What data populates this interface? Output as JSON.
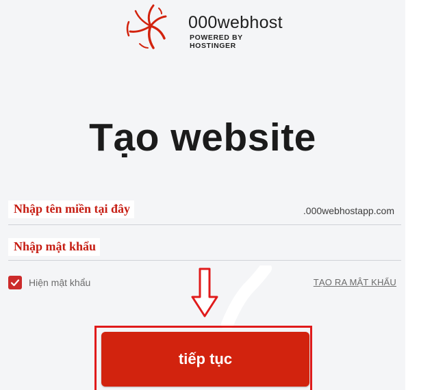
{
  "brand": {
    "name": "000webhost",
    "tagline": "POWERED BY HOSTINGER",
    "logo_icon": "swirl-logo-icon",
    "color": "#d2230e"
  },
  "page": {
    "title": "Tạo website"
  },
  "form": {
    "domain": {
      "annotation": "Nhập tên miền tại đây",
      "suffix": ".000webhostapp.com"
    },
    "password": {
      "annotation": "Nhập mật khẩu"
    },
    "show_password": {
      "label": "Hiện mật khẩu",
      "checked": true
    },
    "generate_password_link": "TẠO RA MẬT KHẨU",
    "submit_label": "tiếp tục"
  },
  "annotations": {
    "arrow_icon": "down-arrow-icon",
    "annotation_color": "#c61d13"
  }
}
